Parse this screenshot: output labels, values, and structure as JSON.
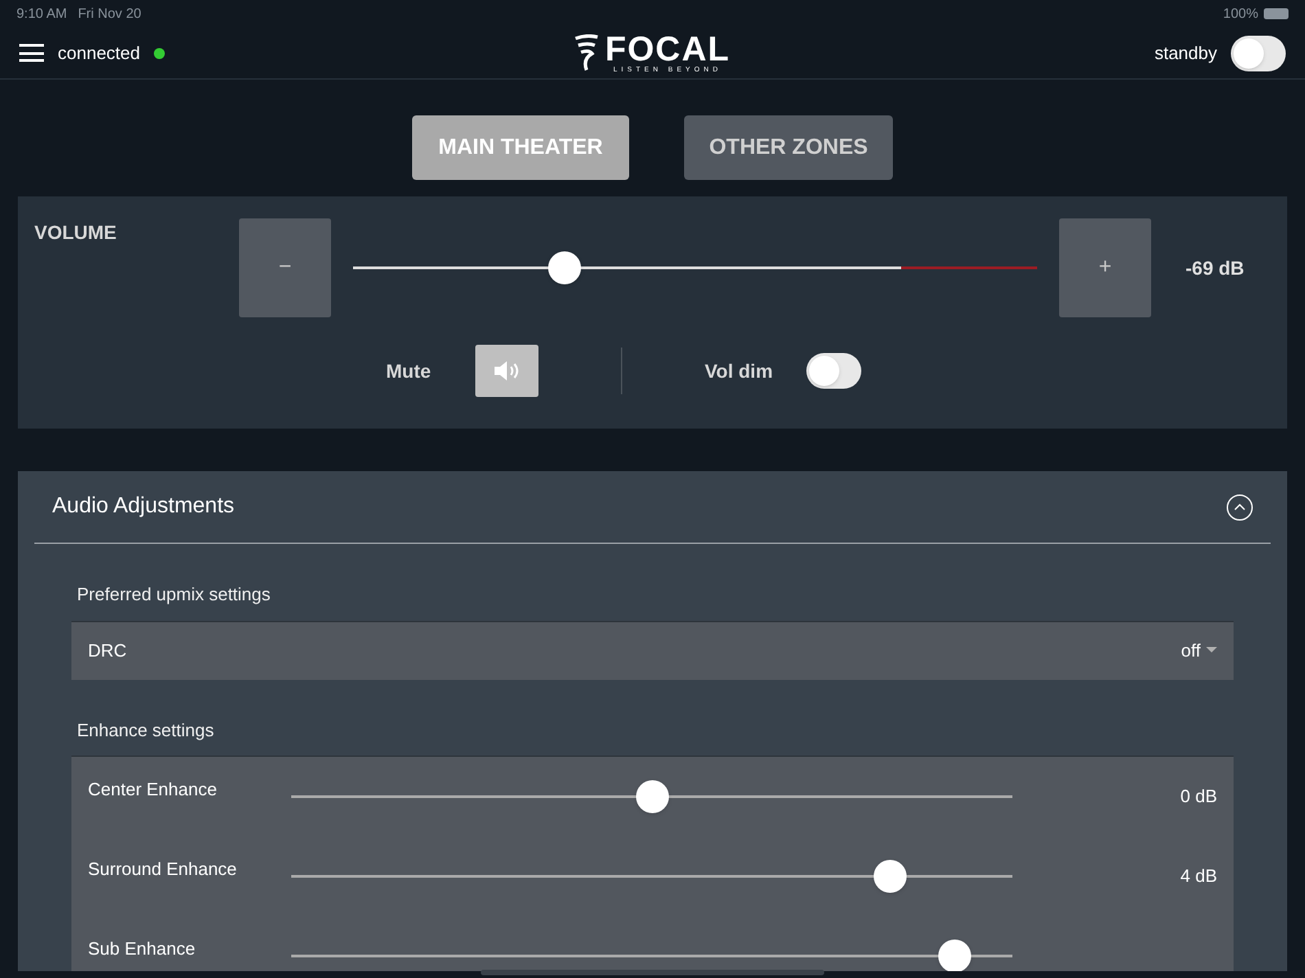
{
  "status_bar": {
    "time": "9:10 AM",
    "date": "Fri Nov 20",
    "battery": "100%"
  },
  "header": {
    "connection": "connected",
    "connected": true,
    "logo": "FOCAL",
    "tagline": "LISTEN BEYOND",
    "standby_label": "standby",
    "standby_on": false
  },
  "tabs": [
    {
      "label": "MAIN THEATER",
      "selected": true
    },
    {
      "label": "OTHER ZONES",
      "selected": false
    }
  ],
  "volume": {
    "title": "VOLUME",
    "minus": "−",
    "plus": "+",
    "level": 0.31,
    "reading": "-69 dB",
    "mute_label": "Mute",
    "muted": false,
    "vol_dim_label": "Vol dim",
    "vol_dim_on": false
  },
  "audio_adjustments": {
    "title": "Audio Adjustments",
    "expanded": true,
    "sections": [
      {
        "title": "Preferred upmix settings",
        "rows": [
          {
            "kind": "dropdown",
            "label": "DRC",
            "value": "off"
          }
        ]
      },
      {
        "title": "Enhance settings",
        "rows": [
          {
            "kind": "slider",
            "label": "Center Enhance",
            "level": 0.5,
            "reading": "0 dB"
          },
          {
            "kind": "slider",
            "label": "Surround Enhance",
            "level": 0.83,
            "reading": "4 dB"
          },
          {
            "kind": "slider",
            "label": "Sub Enhance",
            "level": 0.92
          }
        ]
      }
    ]
  }
}
